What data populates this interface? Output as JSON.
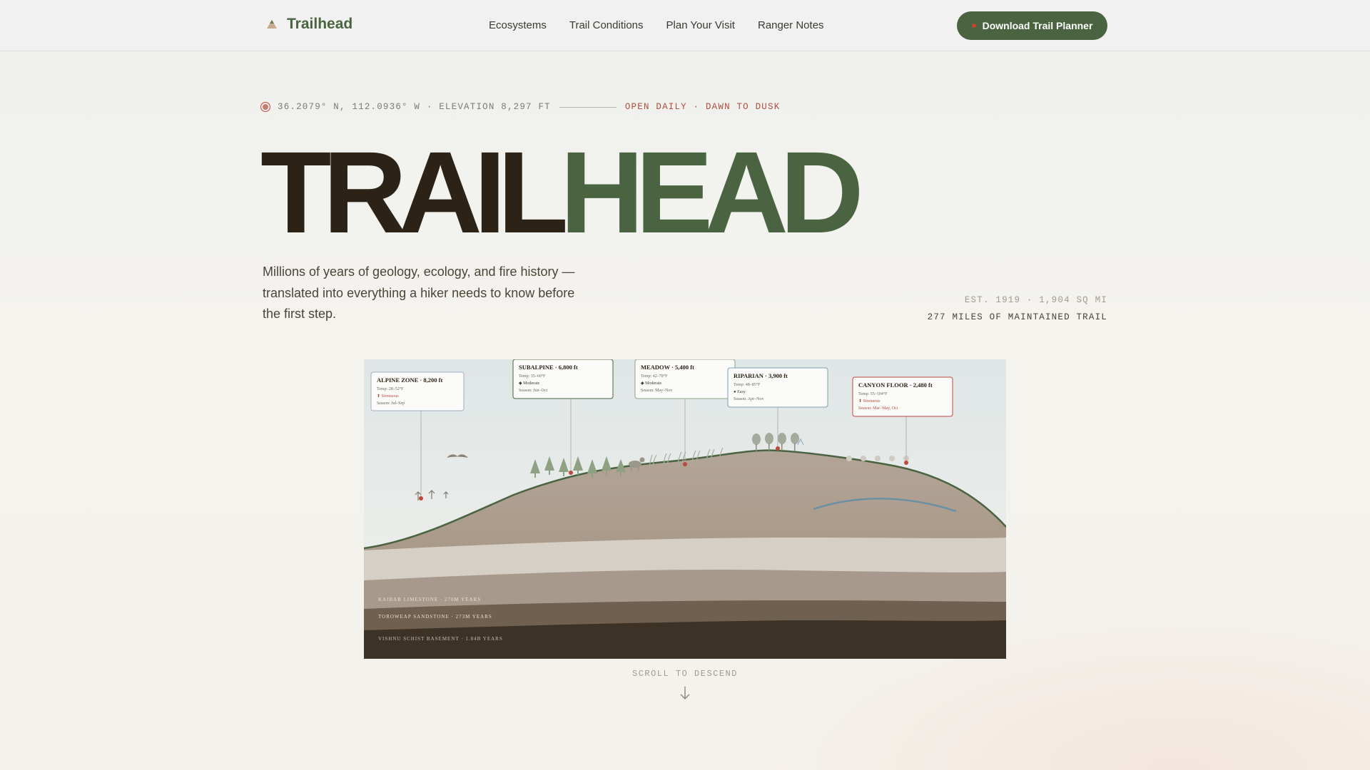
{
  "nav": {
    "brand": "Trailhead",
    "links": [
      "Ecosystems",
      "Trail Conditions",
      "Plan Your Visit",
      "Ranger Notes"
    ],
    "cta_label": "Download Trail Planner"
  },
  "hero": {
    "coords": "36.2079° N, 112.0936° W · ELEVATION 8,297 FT",
    "hours": "OPEN DAILY · DAWN TO DUSK",
    "title_part1": "TRAIL",
    "title_part2": "HEAD",
    "subtitle": "Millions of years of geology, ecology, and fire history — translated into everything a hiker needs to know before the first step.",
    "stat_established": "EST. 1919 · 1,904 SQ MI",
    "stat_trail": "277 MILES OF MAINTAINED TRAIL"
  },
  "zones": [
    {
      "title": "ALPINE ZONE · 8,200 ft",
      "temp": "Temp: 28–52°F",
      "risk": "⬆ Strenuous",
      "season": "Season: Jul–Sep",
      "risk_color": "#b04d3c"
    },
    {
      "title": "SUBALPINE · 6,800 ft",
      "temp": "Temp: 35–60°F",
      "risk": "◆ Moderate",
      "season": "Season: Jun–Oct",
      "risk_color": "#3b3a33"
    },
    {
      "title": "MEADOW · 5,400 ft",
      "temp": "Temp: 42–78°F",
      "risk": "◆ Moderate",
      "season": "Season: May–Nov",
      "risk_color": "#3b3a33"
    },
    {
      "title": "RIPARIAN · 3,900 ft",
      "temp": "Temp: 48–85°F",
      "risk": "● Easy",
      "season": "Season: Apr–Nov",
      "risk_color": "#3b3a33"
    },
    {
      "title": "CANYON FLOOR · 2,480 ft",
      "temp": "Temp: 55–104°F",
      "risk": "⬆ Strenuous",
      "season": "Season: Mar–May, Oct",
      "risk_color": "#b04d3c"
    }
  ],
  "strata": [
    "KAIBAB LIMESTONE · 270M YEARS",
    "TOROWEAP SANDSTONE · 273M YEARS",
    "VISHNU SCHIST BASEMENT · 1.84B YEARS"
  ],
  "scroll_hint": "SCROLL TO DESCEND",
  "colors": {
    "accent": "#4a6340",
    "alert": "#c0483a",
    "ink": "#2c2316"
  }
}
